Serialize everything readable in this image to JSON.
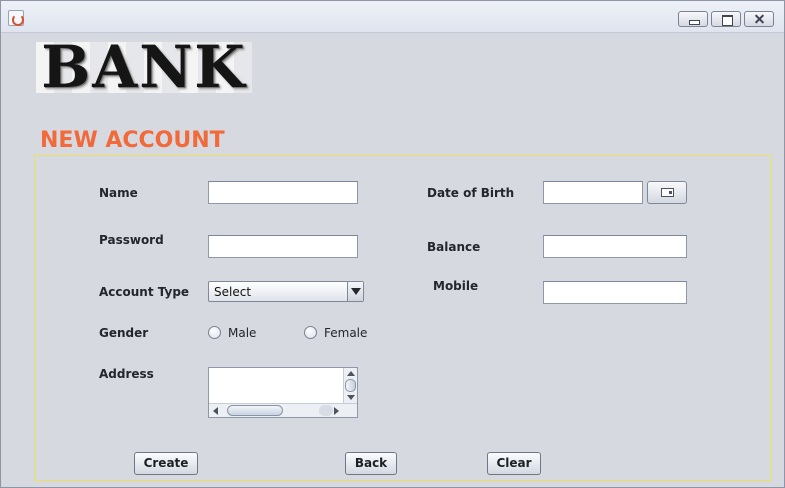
{
  "logo": {
    "text": "BANK"
  },
  "form": {
    "title": "NEW ACCOUNT",
    "name_label": "Name",
    "password_label": "Password",
    "account_type_label": "Account Type",
    "account_type_value": "Select",
    "gender_label": "Gender",
    "gender_options": [
      "Male",
      "Female"
    ],
    "address_label": "Address",
    "dob_label": "Date of Birth",
    "balance_label": "Balance",
    "mobile_label": "Mobile",
    "name_value": "",
    "password_value": "",
    "dob_value": "",
    "balance_value": "",
    "mobile_value": "",
    "address_value": ""
  },
  "buttons": {
    "create": "Create",
    "back": "Back",
    "clear": "Clear"
  },
  "icons": {
    "app": "java-cup-icon",
    "minimize": "minimize-icon",
    "maximize": "maximize-icon",
    "close": "close-icon",
    "calendar": "calendar-icon"
  },
  "colors": {
    "title": "#f26a3a",
    "panel_border": "#eee05d",
    "background": "#d6d9e0"
  }
}
